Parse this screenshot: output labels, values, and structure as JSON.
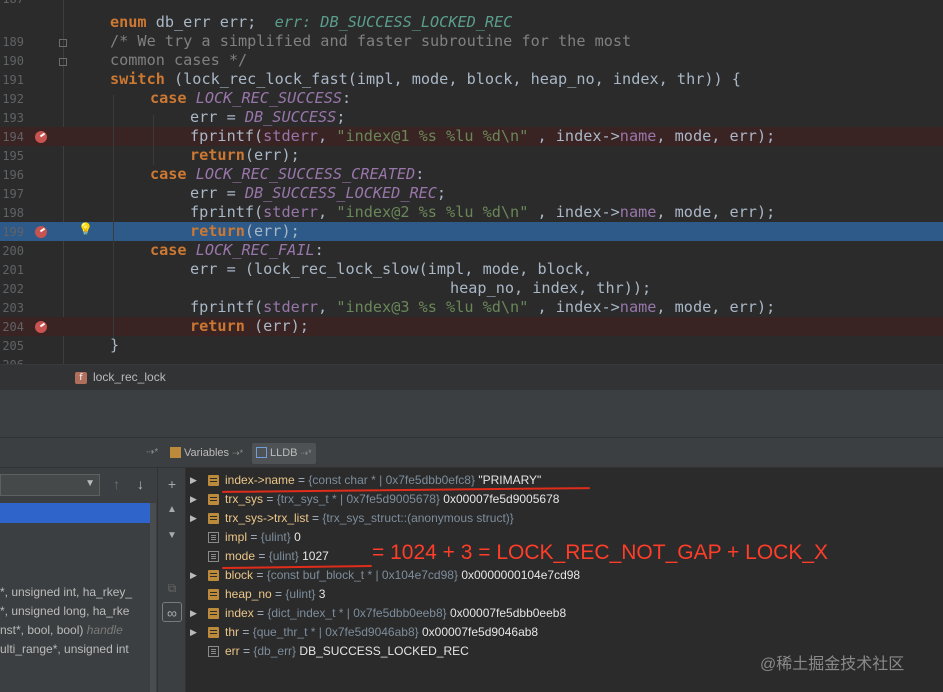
{
  "editor": {
    "lines": [
      {
        "num": "187"
      },
      {
        "num": "189"
      },
      {
        "num": "190"
      },
      {
        "num": "191"
      },
      {
        "num": "192"
      },
      {
        "num": "193"
      },
      {
        "num": "194"
      },
      {
        "num": "195"
      },
      {
        "num": "196"
      },
      {
        "num": "197"
      },
      {
        "num": "198"
      },
      {
        "num": "199"
      },
      {
        "num": "200"
      },
      {
        "num": "201"
      },
      {
        "num": "202"
      },
      {
        "num": "203"
      },
      {
        "num": "204"
      },
      {
        "num": "205"
      },
      {
        "num": "206"
      }
    ],
    "tok": {
      "enum_kw": "enum",
      "db_err_decl": " db_err err;  ",
      "err_inline": "err: DB_SUCCESS_LOCKED_REC",
      "comment1": "/* We try a simplified and faster subroutine for the most",
      "comment2": "common cases */",
      "switch_kw": "switch",
      "switch_rest": " (lock_rec_lock_fast(impl, mode, block, heap_no, index, thr)) {",
      "case_kw": "case",
      "c_success": "LOCK_REC_SUCCESS",
      "colon": ":",
      "err_assign": "err = ",
      "db_success": "DB_SUCCESS",
      "semi": ";",
      "fprintf": "fprintf(",
      "stderr": "stderr",
      "comma_sp": ", ",
      "fmt1": "\"index@1 %s %lu %d\\n\"",
      "fmt2": "\"index@2 %s %lu %d\\n\"",
      "fmt3": "\"index@3 %s %lu %d\\n\"",
      "args_pre": " , index->",
      "name": "name",
      "args_post": ", mode, err);",
      "return_kw": "return",
      "return_rest": "(err);",
      "return_rest_sp": " (err);",
      "c_created": "LOCK_REC_SUCCESS_CREATED",
      "db_locked": "DB_SUCCESS_LOCKED_REC",
      "c_fail": "LOCK_REC_FAIL",
      "slow1": "err = (lock_rec_lock_slow(impl, mode, block,",
      "slow2": "heap_no, index, thr));",
      "close_brace": "}"
    }
  },
  "breadcrumb": {
    "func_icon": "f",
    "label": "lock_rec_lock"
  },
  "debug_tabs": {
    "arrow_left": "⇢*",
    "variables": "Variables",
    "variables_arrow": "⇢*",
    "lldb": "LLDB",
    "lldb_arrow": "⇢*"
  },
  "frames": {
    "rows": [
      {
        "text": "*, unsigned int, ha_rkey_"
      },
      {
        "text": "*, unsigned long, ha_rke"
      },
      {
        "text": "nst*, bool, bool) ",
        "italic": "handle"
      },
      {
        "text": "ulti_range*, unsigned int"
      }
    ]
  },
  "variables": [
    {
      "name": "index->name",
      "type": "{const char * | 0x7fe5dbb0efc8}",
      "value": "\"PRIMARY\""
    },
    {
      "name": "trx_sys",
      "type": "{trx_sys_t * | 0x7fe5d9005678}",
      "value": "0x00007fe5d9005678"
    },
    {
      "name": "trx_sys->trx_list",
      "type": "{trx_sys_struct::(anonymous struct)}",
      "value": ""
    },
    {
      "name": "impl",
      "type": "{ulint}",
      "value": "0"
    },
    {
      "name": "mode",
      "type": "{ulint}",
      "value": "1027"
    },
    {
      "name": "block",
      "type": "{const buf_block_t * | 0x104e7cd98}",
      "value": "0x0000000104e7cd98"
    },
    {
      "name": "heap_no",
      "type": "{ulint}",
      "value": "3"
    },
    {
      "name": "index",
      "type": "{dict_index_t * | 0x7fe5dbb0eeb8}",
      "value": "0x00007fe5dbb0eeb8"
    },
    {
      "name": "thr",
      "type": "{que_thr_t * | 0x7fe5d9046ab8}",
      "value": "0x00007fe5d9046ab8"
    },
    {
      "name": "err",
      "type": "{db_err}",
      "value": "DB_SUCCESS_LOCKED_REC"
    }
  ],
  "var_eq": " = ",
  "annotation": "= 1024 + 3 = LOCK_REC_NOT_GAP + LOCK_X",
  "watermark": "@稀土掘金技术社区",
  "colors": {
    "breakpoint": "#c75450",
    "execution_line": "#2d5a88",
    "annotation": "#ff3d29"
  }
}
